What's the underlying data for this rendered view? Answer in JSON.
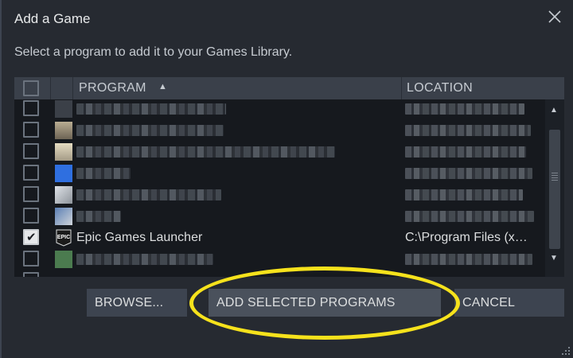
{
  "dialog": {
    "title": "Add a Game",
    "subtitle": "Select a program to add it to your Games Library."
  },
  "list": {
    "columns": {
      "program": "PROGRAM",
      "location": "LOCATION",
      "sort_indicator": "▲"
    },
    "visible_entry": {
      "name": "Epic Games Launcher",
      "location": "C:\\Program Files (x…",
      "checked": true,
      "icon": "epic-games-icon",
      "icon_text": "EPIC"
    }
  },
  "buttons": {
    "browse": "BROWSE...",
    "add_selected": "ADD SELECTED PROGRAMS",
    "cancel": "CANCEL"
  },
  "colors": {
    "background": "#262a31",
    "list_background": "#16191e",
    "header": "#3a404a",
    "button": "#3d4450",
    "highlight": "#f6e21c"
  }
}
